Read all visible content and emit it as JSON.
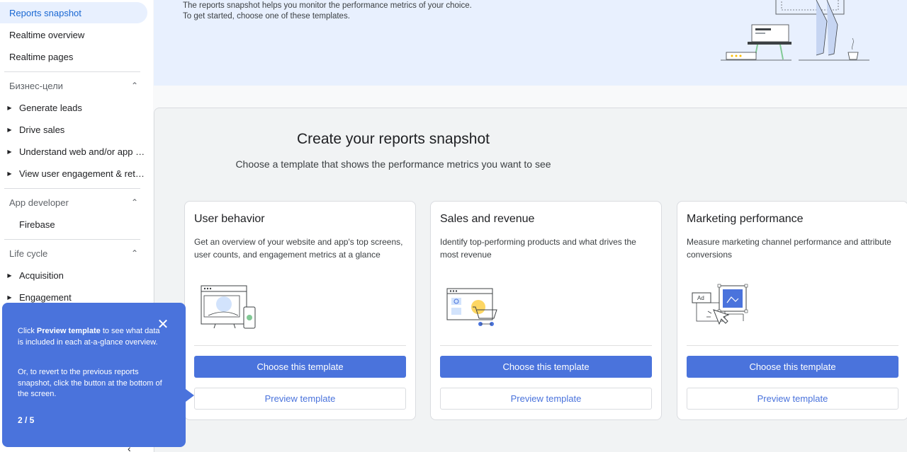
{
  "sidebar": {
    "top_items": [
      {
        "label": "Reports snapshot",
        "active": true
      },
      {
        "label": "Realtime overview",
        "active": false
      },
      {
        "label": "Realtime pages",
        "active": false
      }
    ],
    "sections": [
      {
        "title": "Бизнес-цели",
        "items": [
          "Generate leads",
          "Drive sales",
          "Understand web and/or app t...",
          "View user engagement & rete..."
        ]
      },
      {
        "title": "App developer",
        "items": [
          "Firebase"
        ]
      },
      {
        "title": "Life cycle",
        "items": [
          "Acquisition",
          "Engagement"
        ]
      }
    ]
  },
  "banner": {
    "line1": "The reports snapshot helps you monitor the performance metrics of your choice.",
    "line2": "To get started, choose one of these templates."
  },
  "main": {
    "title": "Create your reports snapshot",
    "subtitle": "Choose a template that shows the performance metrics you want to see",
    "cards": [
      {
        "title": "User behavior",
        "description": "Get an overview of your website and app's top screens, user counts, and engagement metrics at a glance",
        "choose_label": "Choose this template",
        "preview_label": "Preview template"
      },
      {
        "title": "Sales and revenue",
        "description": "Identify top-performing products and what drives the most revenue",
        "choose_label": "Choose this template",
        "preview_label": "Preview template"
      },
      {
        "title": "Marketing performance",
        "description": "Measure marketing channel performance and attribute conversions",
        "choose_label": "Choose this template",
        "preview_label": "Preview template"
      }
    ]
  },
  "tooltip": {
    "p1_prefix": "Click ",
    "p1_bold": "Preview template",
    "p1_suffix": " to see what data is included in each at-a-glance overview.",
    "p2": "Or, to revert to the previous reports snapshot, click the button at the bottom of the screen.",
    "step": "2 / 5",
    "close_icon": "close-icon"
  },
  "illustration": {
    "ad_label": "Ad"
  },
  "colors": {
    "primary": "#4a73dc",
    "active_bg": "#e8f0fe",
    "active_text": "#1967d2",
    "banner_bg": "#e8f0fe"
  }
}
